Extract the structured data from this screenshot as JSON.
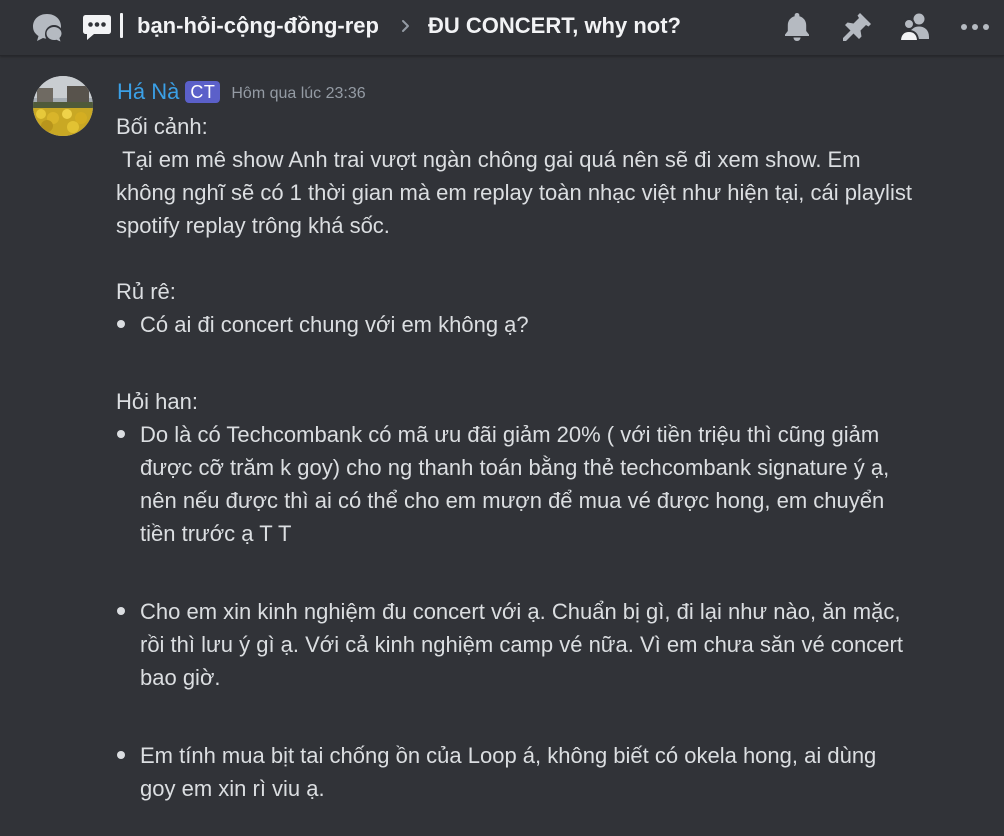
{
  "header": {
    "icons": {
      "threads": "threads-icon",
      "chat": "chat-bubble-icon",
      "chevron": "chevron-right-icon",
      "notifications": "bell-icon",
      "pin": "pin-icon",
      "members": "members-icon",
      "more": "more-options-icon"
    },
    "channel_name": "bạn-hỏi-cộng-đồng-rep",
    "thread_name": "ĐU CONCERT, why not?"
  },
  "message": {
    "username": "Há Nà",
    "role_tag": "CT",
    "timestamp": "Hôm qua lúc 23:36",
    "context_heading": "Bối cảnh:",
    "context_text": " Tại em mê show Anh trai vượt ngàn chông gai quá nên sẽ đi xem show. Em không nghĩ sẽ có 1 thời gian mà em replay toàn nhạc việt như hiện tại, cái playlist spotify replay trông khá sốc.",
    "invite_heading": "Rủ rê:",
    "invite_items": [
      "Có ai đi concert chung với em không ạ?"
    ],
    "questions_heading": "Hỏi han:",
    "question_items": [
      "Do là có Techcombank có mã ưu đãi giảm 20% ( với tiền triệu thì cũng giảm được cỡ trăm k goy) cho ng thanh toán bằng thẻ techcombank signature ý ạ, nên nếu được thì ai có thể cho em mượn để mua vé được hong, em chuyển tiền trước ạ T T",
      "Cho em xin kinh nghiệm đu concert với ạ. Chuẩn bị gì, đi lại như nào, ăn mặc, rồi thì lưu ý gì ạ. Với cả kinh nghiệm camp vé nữa. Vì em chưa săn vé concert bao giờ.",
      "Em tính mua bịt tai chống ồn của Loop á, không biết có okela hong, ai dùng goy em xin rì viu ạ."
    ]
  },
  "colors": {
    "background": "#313338",
    "text": "#dbdee1",
    "username": "#3ba0e6",
    "role_tag": "#5b60c9",
    "timestamp": "#949ba4",
    "icon": "#b5bac1"
  }
}
